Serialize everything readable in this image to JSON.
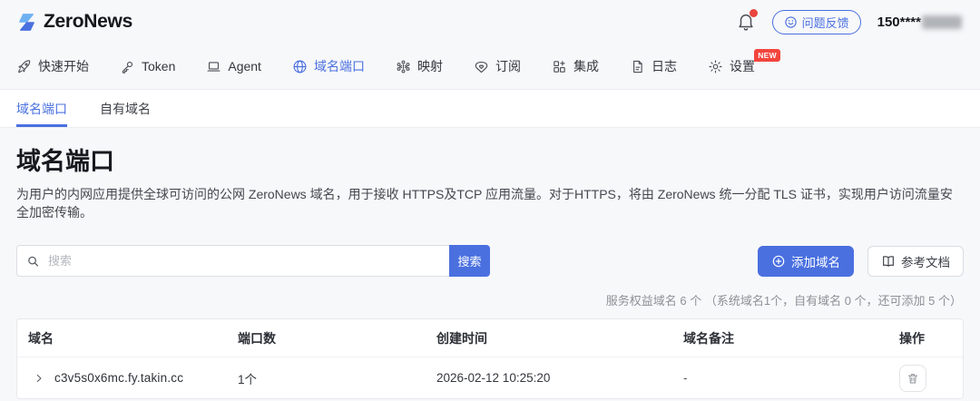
{
  "brand": {
    "name": "ZeroNews"
  },
  "header": {
    "feedback_label": "问题反馈",
    "account_masked": "150****",
    "has_notification_dot": true
  },
  "nav": {
    "items": [
      {
        "label": "快速开始",
        "icon": "rocket-icon",
        "active": false
      },
      {
        "label": "Token",
        "icon": "key-icon",
        "active": false
      },
      {
        "label": "Agent",
        "icon": "laptop-icon",
        "active": false
      },
      {
        "label": "域名端口",
        "icon": "globe-icon",
        "active": true
      },
      {
        "label": "映射",
        "icon": "nodes-icon",
        "active": false
      },
      {
        "label": "订阅",
        "icon": "heart-badge-icon",
        "active": false
      },
      {
        "label": "集成",
        "icon": "grid-plus-icon",
        "active": false
      },
      {
        "label": "日志",
        "icon": "document-icon",
        "active": false
      },
      {
        "label": "设置",
        "icon": "gear-icon",
        "active": false,
        "badge": "NEW"
      }
    ]
  },
  "tabs": [
    {
      "label": "域名端口",
      "active": true
    },
    {
      "label": "自有域名",
      "active": false
    }
  ],
  "page": {
    "title": "域名端口",
    "description": "为用户的内网应用提供全球可访问的公网 ZeroNews 域名，用于接收 HTTPS及TCP 应用流量。对于HTTPS，将由 ZeroNews 统一分配 TLS 证书，实现用户访问流量安全加密传输。"
  },
  "toolbar": {
    "search_placeholder": "搜索",
    "search_button_label": "搜索",
    "add_domain_label": "添加域名",
    "docs_label": "参考文档"
  },
  "quota": {
    "text": "服务权益域名 6 个 （系统域名1个，自有域名 0 个，还可添加 5 个）"
  },
  "table": {
    "columns": [
      "域名",
      "端口数",
      "创建时间",
      "域名备注",
      "操作"
    ],
    "rows": [
      {
        "domain": "c3v5s0x6mc.fy.takin.cc",
        "ports": "1个",
        "created_at": "2026-02-12 10:25:20",
        "note": "-"
      }
    ]
  },
  "colors": {
    "accent_blue": "#4a70e0",
    "badge_red": "#f2453d",
    "notification_red": "#e8453c",
    "page_bg": "#f7f8fa"
  }
}
